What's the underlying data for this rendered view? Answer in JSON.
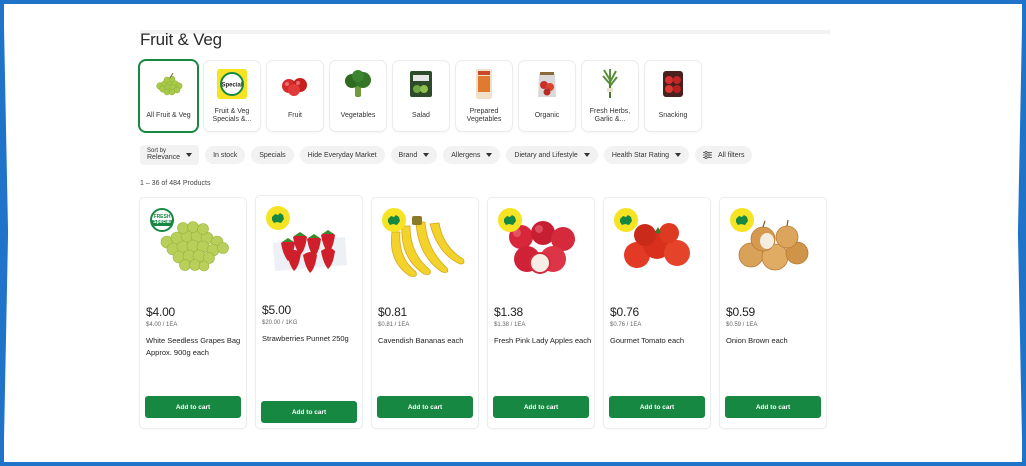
{
  "page": {
    "title": "Fruit & Veg"
  },
  "categories": [
    {
      "label": "All Fruit & Veg",
      "icon": "grapes-icon",
      "active": true
    },
    {
      "label": "Fruit & Veg Specials &...",
      "icon": "special-tag-icon",
      "active": false
    },
    {
      "label": "Fruit",
      "icon": "apples-icon",
      "active": false
    },
    {
      "label": "Vegetables",
      "icon": "broccoli-icon",
      "active": false
    },
    {
      "label": "Salad",
      "icon": "salad-bag-icon",
      "active": false
    },
    {
      "label": "Prepared Vegetables",
      "icon": "prepared-veg-icon",
      "active": false
    },
    {
      "label": "Organic",
      "icon": "organic-bag-icon",
      "active": false
    },
    {
      "label": "Fresh Herbs, Garlic &...",
      "icon": "herbs-icon",
      "active": false
    },
    {
      "label": "Snacking",
      "icon": "snacking-tub-icon",
      "active": false
    }
  ],
  "filters": {
    "sort_label": "Sort by",
    "sort_value": "Relevance",
    "chips": [
      {
        "label": "In stock",
        "dropdown": false
      },
      {
        "label": "Specials",
        "dropdown": false
      },
      {
        "label": "Hide Everyday Market",
        "dropdown": false
      },
      {
        "label": "Brand",
        "dropdown": true
      },
      {
        "label": "Allergens",
        "dropdown": true
      },
      {
        "label": "Dietary and Lifestyle",
        "dropdown": true
      },
      {
        "label": "Health Star Rating",
        "dropdown": true
      }
    ],
    "all_filters": "All filters"
  },
  "results": {
    "count_text": "1 – 36 of 484 Products"
  },
  "products": [
    {
      "price": "$4.00",
      "unit": "$4.00 / 1EA",
      "name": "White Seedless Grapes Bag Approx. 900g each",
      "badge": "fresh-special",
      "badge_top": "FRESH",
      "badge_bottom": "Special",
      "cart": "Add to cart",
      "icon": "grapes-icon"
    },
    {
      "price": "$5.00",
      "unit": "$20.00 / 1KG",
      "name": "Strawberries Punnet 250g",
      "badge": "australian-grown",
      "cart": "Add to cart",
      "icon": "strawberries-icon"
    },
    {
      "price": "$0.81",
      "unit": "$0.81 / 1EA",
      "name": "Cavendish Bananas each",
      "badge": "australian-grown",
      "cart": "Add to cart",
      "icon": "bananas-icon"
    },
    {
      "price": "$1.38",
      "unit": "$1.38 / 1EA",
      "name": "Fresh Pink Lady Apples each",
      "badge": "australian-grown",
      "cart": "Add to cart",
      "icon": "apples-icon"
    },
    {
      "price": "$0.76",
      "unit": "$0.76 / 1EA",
      "name": "Gourmet Tomato each",
      "badge": "australian-grown",
      "cart": "Add to cart",
      "icon": "tomatoes-icon"
    },
    {
      "price": "$0.59",
      "unit": "$0.59 / 1EA",
      "name": "Onion Brown each",
      "badge": "australian-grown",
      "cart": "Add to cart",
      "icon": "onions-icon"
    }
  ],
  "colors": {
    "brand_green": "#178841",
    "badge_yellow": "#f6e424",
    "frame_blue": "#1f73c9"
  }
}
